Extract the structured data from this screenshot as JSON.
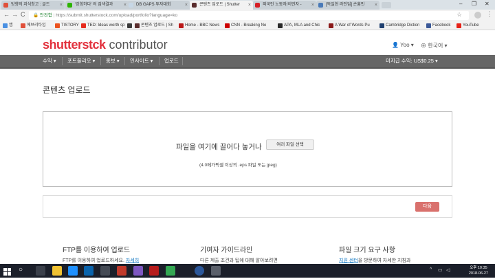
{
  "browser": {
    "tabs": [
      {
        "label": "방향의 지식창고 : 글드",
        "color": "#e0503a",
        "active": false
      },
      {
        "label": "'강희하다' 의 검색결과",
        "color": "#2db400",
        "active": false
      },
      {
        "label": "DB GAPS 투자대회",
        "color": "#c7d7e6",
        "active": false
      },
      {
        "label": "콘텐츠 업로드 | Shutter",
        "color": "#5a2d2d",
        "active": true
      },
      {
        "label": "외국인 노동자/이민자 -",
        "color": "#d61f26",
        "active": false
      },
      {
        "label": "[독일헌 라인업] 손흥민",
        "color": "#4a7ab8",
        "active": false
      }
    ],
    "window_controls": {
      "minimize": "–",
      "restore": "❐",
      "close": "✕"
    },
    "nav": {
      "back": "←",
      "forward": "→",
      "reload": "C"
    },
    "address": {
      "secure_label": "안전함",
      "url": "https://submit.shutterstock.com/upload/portfolio?language=ko"
    },
    "star_icon": "star-icon",
    "bookmarks": [
      {
        "label": "앱",
        "color": "#4a90e2"
      },
      {
        "label": "에브리타임",
        "color": "#e0503a"
      },
      {
        "label": "TISTORY",
        "color": "#eb531f"
      },
      {
        "label": "TED: Ideas worth sp",
        "color": "#e62b1e"
      },
      {
        "label": "",
        "color": "#3a3a3a"
      },
      {
        "label": "콘텐츠 업로드 | Sh",
        "color": "#5a2d2d"
      },
      {
        "label": "Home - BBC News",
        "color": "#bb1919"
      },
      {
        "label": "CNN - Breaking Ne",
        "color": "#cc0000"
      },
      {
        "label": "APA, MLA and Chic",
        "color": "#2a2a2a"
      },
      {
        "label": "A War of Words Pu",
        "color": "#8b1a1a"
      },
      {
        "label": "Cambridge Diction",
        "color": "#1f3f6f"
      },
      {
        "label": "Facebook",
        "color": "#3b5998"
      },
      {
        "label": "YouTube",
        "color": "#e62117"
      }
    ]
  },
  "site": {
    "logo_part1": "shutterstck",
    "logo_part2": " contributor",
    "user_label": "Yoo ▾",
    "language_label": "한국어 ▾",
    "nav": [
      {
        "label": "수익 ▾"
      },
      {
        "label": "포트폴리오 ▾"
      },
      {
        "label": "홍보 ▾"
      },
      {
        "label": "인사이트 ▾"
      },
      {
        "label": "업로드"
      }
    ],
    "pending_earnings": "미지급 수익: US$0.25 ▾"
  },
  "page": {
    "title": "콘텐츠 업로드",
    "dropzone_text": "파일을 여기에 끌어다 놓거나",
    "select_button": "여러 파일 선택",
    "hint": "(4.0메가픽셀 이상의 .eps 파일 또는 jpeg)",
    "next_button": "다음",
    "columns": [
      {
        "title": "FTP를 이용하여 업로드",
        "text": "FTP를 이용하여 업로드하세요. ",
        "link": "자세히"
      },
      {
        "title": "기여자 가이드라인",
        "text": "다른 제출 조건과 팁에 대해 알아보려면",
        "link": ""
      },
      {
        "title": "파일 크기 요구 사항",
        "text": "을 방문하여 자세한 지침과",
        "link": "지원 센터"
      }
    ]
  },
  "taskbar": {
    "start_icon": "windows-icon",
    "search_icon": "search-icon",
    "clock_time": "오후 10:35",
    "clock_date": "2018-06-27",
    "apps": [
      {
        "name": "task-view",
        "color": "#3a3f4a"
      },
      {
        "name": "file-explorer",
        "color": "#f1c232"
      },
      {
        "name": "internet-explorer",
        "color": "#1e90ff"
      },
      {
        "name": "outlook",
        "color": "#0a64ad"
      },
      {
        "name": "app-5",
        "color": "#444a55"
      },
      {
        "name": "app-6",
        "color": "#c0392b"
      },
      {
        "name": "app-7",
        "color": "#7e57c2"
      },
      {
        "name": "app-8",
        "color": "#b71c1c"
      },
      {
        "name": "chrome",
        "color": "#34a853"
      },
      {
        "name": "word",
        "color": "#2b579a"
      },
      {
        "name": "app-11",
        "color": "#5a5f6a"
      }
    ]
  }
}
